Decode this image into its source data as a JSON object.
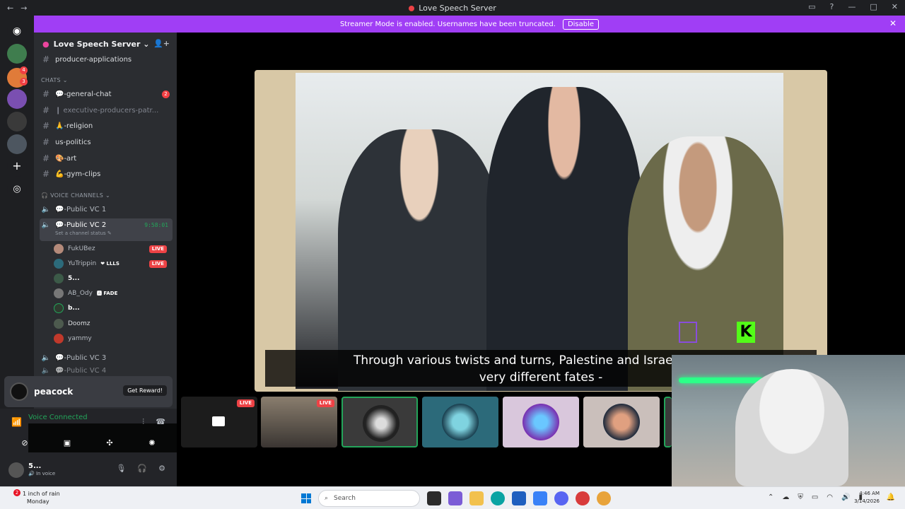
{
  "window": {
    "title": "Love Speech Server",
    "controls": [
      "▭",
      "?",
      "—",
      "□",
      "✕"
    ]
  },
  "banner": {
    "text": "Streamer Mode is enabled. Usernames have been truncated.",
    "button": "Disable"
  },
  "rail": {
    "badges": [
      "4",
      "3"
    ]
  },
  "server": {
    "name": "Love Speech Server ⌄"
  },
  "channels": {
    "top": "producer-applications",
    "category_chats": "CHATS ⌄",
    "items": [
      {
        "label": "💬-general-chat",
        "mention": "2"
      },
      {
        "label": "❙ executive-producers-patr..."
      },
      {
        "label": "🙏-religion"
      },
      {
        "label": "us-politics"
      },
      {
        "label": "🎨-art"
      },
      {
        "label": "💪-gym-clips"
      }
    ],
    "category_voice": "🎧 VOICE CHANNELS ⌄",
    "voice": [
      {
        "label": "💬-Public VC 1"
      },
      {
        "label": "💬-Public VC 2",
        "timer": "9:58:01",
        "status": "Set a channel status ✎"
      },
      {
        "label": "💬-Public VC 3"
      },
      {
        "label": "💬-Public VC 4"
      }
    ],
    "users": [
      {
        "name": "FukUBez",
        "live": "LIVE"
      },
      {
        "name": "YuTrippin",
        "tag": "❤ LLLS",
        "live": "LIVE"
      },
      {
        "name": "5..."
      },
      {
        "name": "AB_Ody",
        "tag": "🅰 FADE"
      },
      {
        "name": "b..."
      },
      {
        "name": "Doomz"
      },
      {
        "name": "yammy"
      }
    ]
  },
  "promo": {
    "brand": "peacock",
    "button": "Get Reward!"
  },
  "voice_connected": {
    "title": "Voice Connected",
    "subtitle": "💬-Public VC 2 / Love Speech Server"
  },
  "userbar": {
    "name": "5...",
    "status": "🔊 In voice"
  },
  "subtitle": {
    "line1": "Through various twists and turns, Palestine and Israel have go",
    "line2": "very different fates -"
  },
  "tiles": {
    "live_labels": [
      "LIVE",
      "LIVE"
    ],
    "colors": [
      "#1c1c1c",
      "#3a3532",
      "#3a3a3a",
      "#2c6a7a",
      "#d9c7dc",
      "#cabfbb",
      "#3a3a3a"
    ]
  },
  "overlay": {
    "kick": "K"
  },
  "taskbar": {
    "weather_badge": "2",
    "weather": "1 inch of rain",
    "day": "Monday",
    "search": "Search",
    "time": "4:46 AM",
    "date": "3/14/2026"
  }
}
